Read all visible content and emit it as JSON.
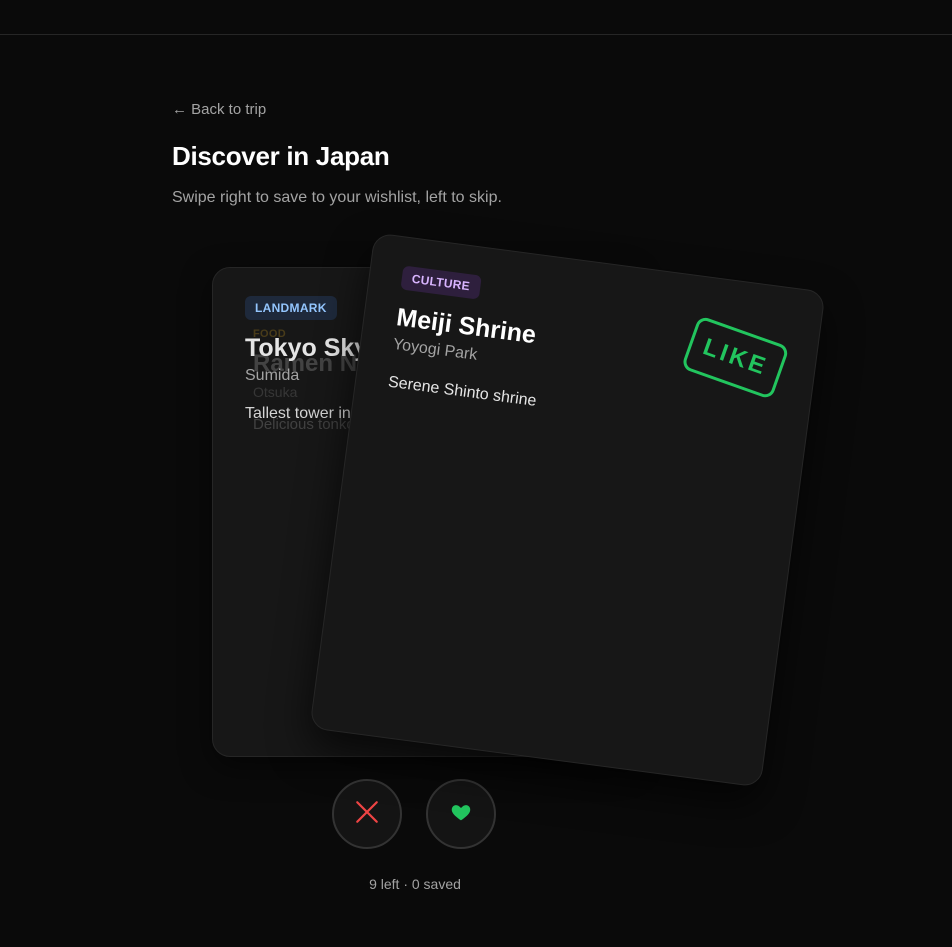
{
  "nav": {
    "back_label": "← Back to trip"
  },
  "header": {
    "title": "Discover in Japan",
    "subtitle": "Swipe right to save to your wishlist, left to skip."
  },
  "cards": {
    "back": {
      "tag": "LANDMARK",
      "title": "Tokyo Skytree",
      "location": "Sumida",
      "description": "Tallest tower in Japan",
      "ghost": {
        "tag": "FOOD",
        "title": "Ramen Nagi",
        "location": "Otsuka",
        "description": "Delicious tonkotsu ramen"
      }
    },
    "front": {
      "tag": "CULTURE",
      "title": "Meiji Shrine",
      "location": "Yoyogi Park",
      "description": "Serene Shinto shrine",
      "stamp": "LIKE"
    }
  },
  "actions": {
    "skip_icon": "close-icon",
    "like_icon": "heart-icon"
  },
  "status": {
    "text": "9 left · 0 saved"
  },
  "colors": {
    "background": "#0a0a0a",
    "card": "#171717",
    "like": "#22c55e",
    "skip": "#ef4444",
    "culture_tag": "#d8b4fe",
    "landmark_tag": "#93c5fd"
  }
}
